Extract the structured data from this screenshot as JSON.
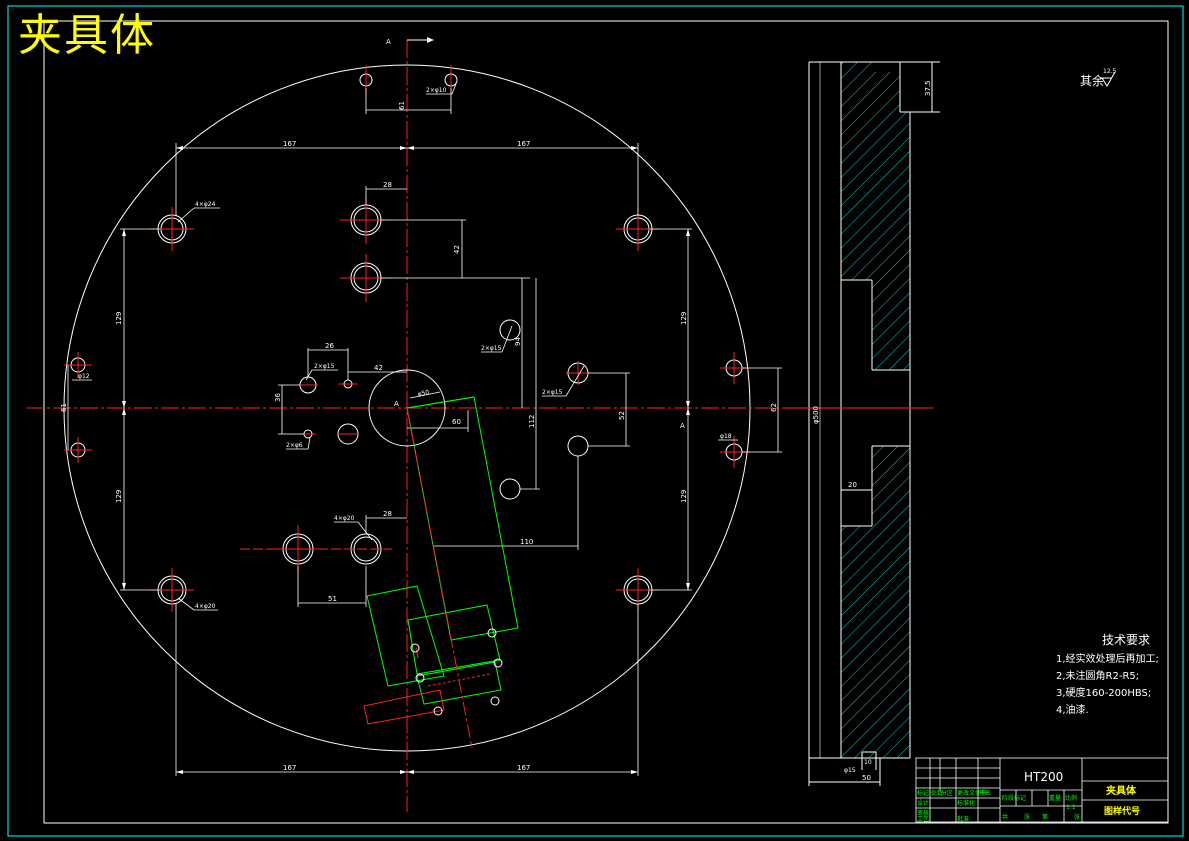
{
  "drawing": {
    "title": "夹具体",
    "material": "HT200",
    "part_name": "夹具体",
    "drawing_code_label": "图样代号",
    "roughness_note": "其余",
    "roughness_value": "12.5",
    "scale": "1:1",
    "section_label": "A",
    "tech_requirements": {
      "heading": "技术要求",
      "items": [
        "1,经实效处理后再加工;",
        "2,未注圆角R2-R5;",
        "3,硬度160-200HBS;",
        "4,油漆."
      ]
    }
  },
  "dimensions": {
    "d167": "167",
    "d61": "61",
    "d28": "28",
    "d42": "42",
    "d129": "129",
    "d36": "36",
    "d26": "26",
    "d60": "60",
    "d94": "94",
    "d112": "112",
    "d52": "52",
    "d110": "110",
    "d51": "51",
    "d62": "62",
    "d500": "φ500",
    "d20": "20",
    "d50": "50",
    "d10": "10",
    "d375": "37.5",
    "hole_2x10": "2×φ10",
    "hole_4x24": "4×φ24",
    "hole_4x20a": "4×φ20",
    "hole_4x20b": "4×φ20",
    "hole_2x15a": "2×φ15",
    "hole_2x15b": "2×φ15",
    "hole_2x15c": "2×φ15",
    "hole_2x6": "2×φ6",
    "hole_12": "φ12",
    "hole_18": "φ18",
    "hole_50": "φ50",
    "hole_15": "φ15"
  },
  "title_block": {
    "text_mark": "标记",
    "text_count": "处数",
    "text_zone": "分区",
    "text_change": "更改文件号",
    "text_sign": "签名",
    "text_date": "年月日",
    "text_design": "设计",
    "text_std": "标准化",
    "text_check": "审核",
    "text_craft": "工艺",
    "text_approve": "批准",
    "text_stage": "阶段标记",
    "text_weight": "重量",
    "text_ratio": "比例",
    "text_total": "共",
    "text_sheet": "张",
    "text_page": "第"
  }
}
